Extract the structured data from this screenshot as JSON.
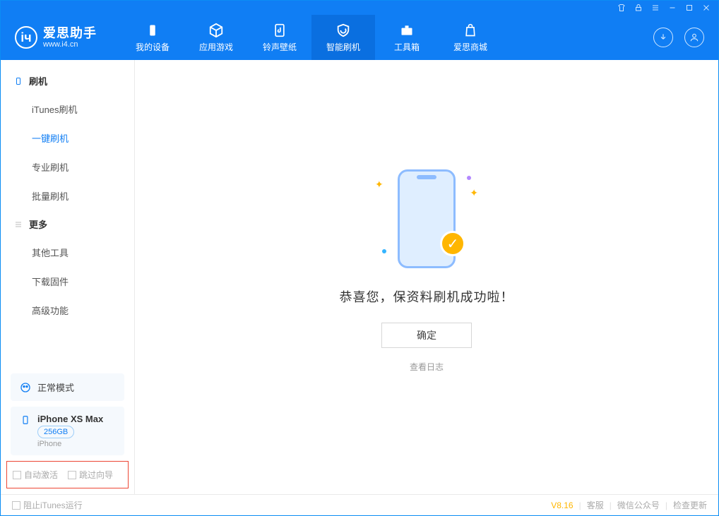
{
  "app": {
    "name_cn": "爱思助手",
    "name_en": "www.i4.cn"
  },
  "nav": {
    "items": [
      {
        "label": "我的设备"
      },
      {
        "label": "应用游戏"
      },
      {
        "label": "铃声壁纸"
      },
      {
        "label": "智能刷机"
      },
      {
        "label": "工具箱"
      },
      {
        "label": "爱思商城"
      }
    ]
  },
  "sidebar": {
    "section1": {
      "title": "刷机",
      "items": [
        {
          "label": "iTunes刷机"
        },
        {
          "label": "一键刷机"
        },
        {
          "label": "专业刷机"
        },
        {
          "label": "批量刷机"
        }
      ]
    },
    "section2": {
      "title": "更多",
      "items": [
        {
          "label": "其他工具"
        },
        {
          "label": "下载固件"
        },
        {
          "label": "高级功能"
        }
      ]
    },
    "mode": {
      "label": "正常模式"
    },
    "device": {
      "name": "iPhone XS Max",
      "storage": "256GB",
      "type": "iPhone"
    },
    "options": {
      "auto_activate": "自动激活",
      "skip_guide": "跳过向导"
    }
  },
  "main": {
    "success_title": "恭喜您，保资料刷机成功啦！",
    "confirm_btn": "确定",
    "view_log": "查看日志"
  },
  "footer": {
    "block_itunes": "阻止iTunes运行",
    "version": "V8.16",
    "support": "客服",
    "wechat": "微信公众号",
    "check_update": "检查更新"
  }
}
